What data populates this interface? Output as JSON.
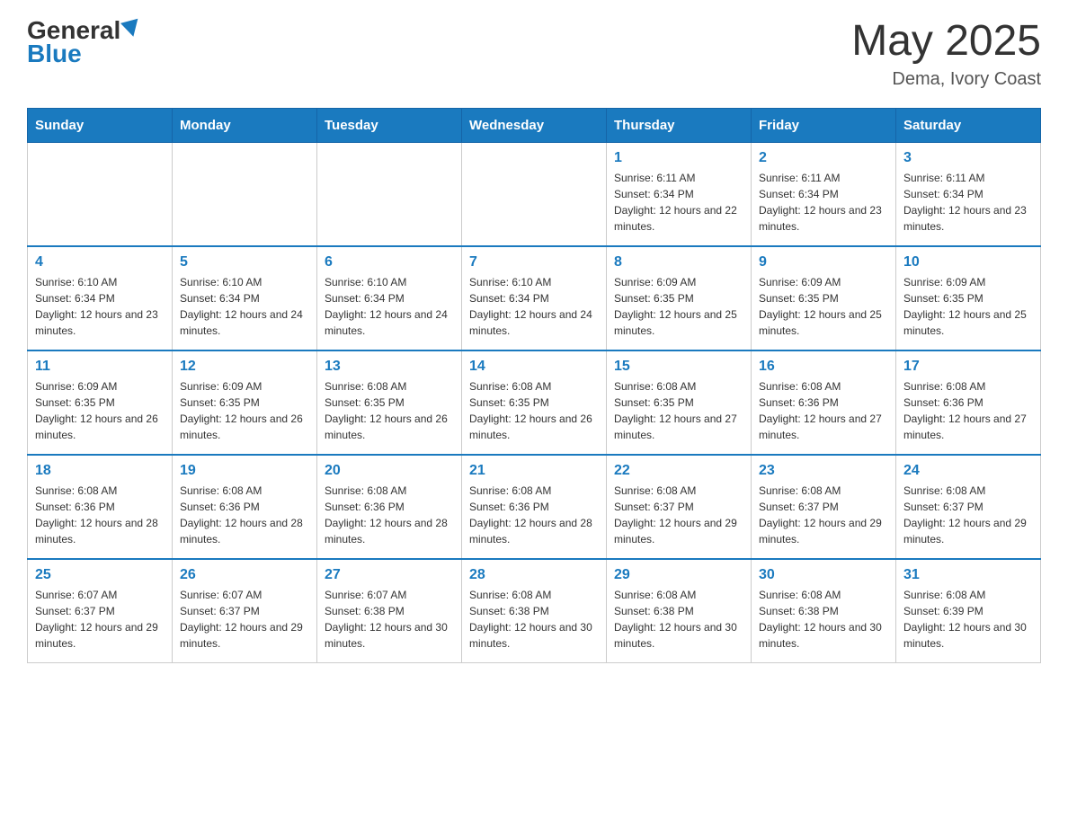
{
  "header": {
    "logo_text_general": "General",
    "logo_text_blue": "Blue",
    "month_year": "May 2025",
    "location": "Dema, Ivory Coast"
  },
  "days_of_week": [
    "Sunday",
    "Monday",
    "Tuesday",
    "Wednesday",
    "Thursday",
    "Friday",
    "Saturday"
  ],
  "weeks": [
    [
      {
        "day": "",
        "info": ""
      },
      {
        "day": "",
        "info": ""
      },
      {
        "day": "",
        "info": ""
      },
      {
        "day": "",
        "info": ""
      },
      {
        "day": "1",
        "info": "Sunrise: 6:11 AM\nSunset: 6:34 PM\nDaylight: 12 hours and 22 minutes."
      },
      {
        "day": "2",
        "info": "Sunrise: 6:11 AM\nSunset: 6:34 PM\nDaylight: 12 hours and 23 minutes."
      },
      {
        "day": "3",
        "info": "Sunrise: 6:11 AM\nSunset: 6:34 PM\nDaylight: 12 hours and 23 minutes."
      }
    ],
    [
      {
        "day": "4",
        "info": "Sunrise: 6:10 AM\nSunset: 6:34 PM\nDaylight: 12 hours and 23 minutes."
      },
      {
        "day": "5",
        "info": "Sunrise: 6:10 AM\nSunset: 6:34 PM\nDaylight: 12 hours and 24 minutes."
      },
      {
        "day": "6",
        "info": "Sunrise: 6:10 AM\nSunset: 6:34 PM\nDaylight: 12 hours and 24 minutes."
      },
      {
        "day": "7",
        "info": "Sunrise: 6:10 AM\nSunset: 6:34 PM\nDaylight: 12 hours and 24 minutes."
      },
      {
        "day": "8",
        "info": "Sunrise: 6:09 AM\nSunset: 6:35 PM\nDaylight: 12 hours and 25 minutes."
      },
      {
        "day": "9",
        "info": "Sunrise: 6:09 AM\nSunset: 6:35 PM\nDaylight: 12 hours and 25 minutes."
      },
      {
        "day": "10",
        "info": "Sunrise: 6:09 AM\nSunset: 6:35 PM\nDaylight: 12 hours and 25 minutes."
      }
    ],
    [
      {
        "day": "11",
        "info": "Sunrise: 6:09 AM\nSunset: 6:35 PM\nDaylight: 12 hours and 26 minutes."
      },
      {
        "day": "12",
        "info": "Sunrise: 6:09 AM\nSunset: 6:35 PM\nDaylight: 12 hours and 26 minutes."
      },
      {
        "day": "13",
        "info": "Sunrise: 6:08 AM\nSunset: 6:35 PM\nDaylight: 12 hours and 26 minutes."
      },
      {
        "day": "14",
        "info": "Sunrise: 6:08 AM\nSunset: 6:35 PM\nDaylight: 12 hours and 26 minutes."
      },
      {
        "day": "15",
        "info": "Sunrise: 6:08 AM\nSunset: 6:35 PM\nDaylight: 12 hours and 27 minutes."
      },
      {
        "day": "16",
        "info": "Sunrise: 6:08 AM\nSunset: 6:36 PM\nDaylight: 12 hours and 27 minutes."
      },
      {
        "day": "17",
        "info": "Sunrise: 6:08 AM\nSunset: 6:36 PM\nDaylight: 12 hours and 27 minutes."
      }
    ],
    [
      {
        "day": "18",
        "info": "Sunrise: 6:08 AM\nSunset: 6:36 PM\nDaylight: 12 hours and 28 minutes."
      },
      {
        "day": "19",
        "info": "Sunrise: 6:08 AM\nSunset: 6:36 PM\nDaylight: 12 hours and 28 minutes."
      },
      {
        "day": "20",
        "info": "Sunrise: 6:08 AM\nSunset: 6:36 PM\nDaylight: 12 hours and 28 minutes."
      },
      {
        "day": "21",
        "info": "Sunrise: 6:08 AM\nSunset: 6:36 PM\nDaylight: 12 hours and 28 minutes."
      },
      {
        "day": "22",
        "info": "Sunrise: 6:08 AM\nSunset: 6:37 PM\nDaylight: 12 hours and 29 minutes."
      },
      {
        "day": "23",
        "info": "Sunrise: 6:08 AM\nSunset: 6:37 PM\nDaylight: 12 hours and 29 minutes."
      },
      {
        "day": "24",
        "info": "Sunrise: 6:08 AM\nSunset: 6:37 PM\nDaylight: 12 hours and 29 minutes."
      }
    ],
    [
      {
        "day": "25",
        "info": "Sunrise: 6:07 AM\nSunset: 6:37 PM\nDaylight: 12 hours and 29 minutes."
      },
      {
        "day": "26",
        "info": "Sunrise: 6:07 AM\nSunset: 6:37 PM\nDaylight: 12 hours and 29 minutes."
      },
      {
        "day": "27",
        "info": "Sunrise: 6:07 AM\nSunset: 6:38 PM\nDaylight: 12 hours and 30 minutes."
      },
      {
        "day": "28",
        "info": "Sunrise: 6:08 AM\nSunset: 6:38 PM\nDaylight: 12 hours and 30 minutes."
      },
      {
        "day": "29",
        "info": "Sunrise: 6:08 AM\nSunset: 6:38 PM\nDaylight: 12 hours and 30 minutes."
      },
      {
        "day": "30",
        "info": "Sunrise: 6:08 AM\nSunset: 6:38 PM\nDaylight: 12 hours and 30 minutes."
      },
      {
        "day": "31",
        "info": "Sunrise: 6:08 AM\nSunset: 6:39 PM\nDaylight: 12 hours and 30 minutes."
      }
    ]
  ]
}
